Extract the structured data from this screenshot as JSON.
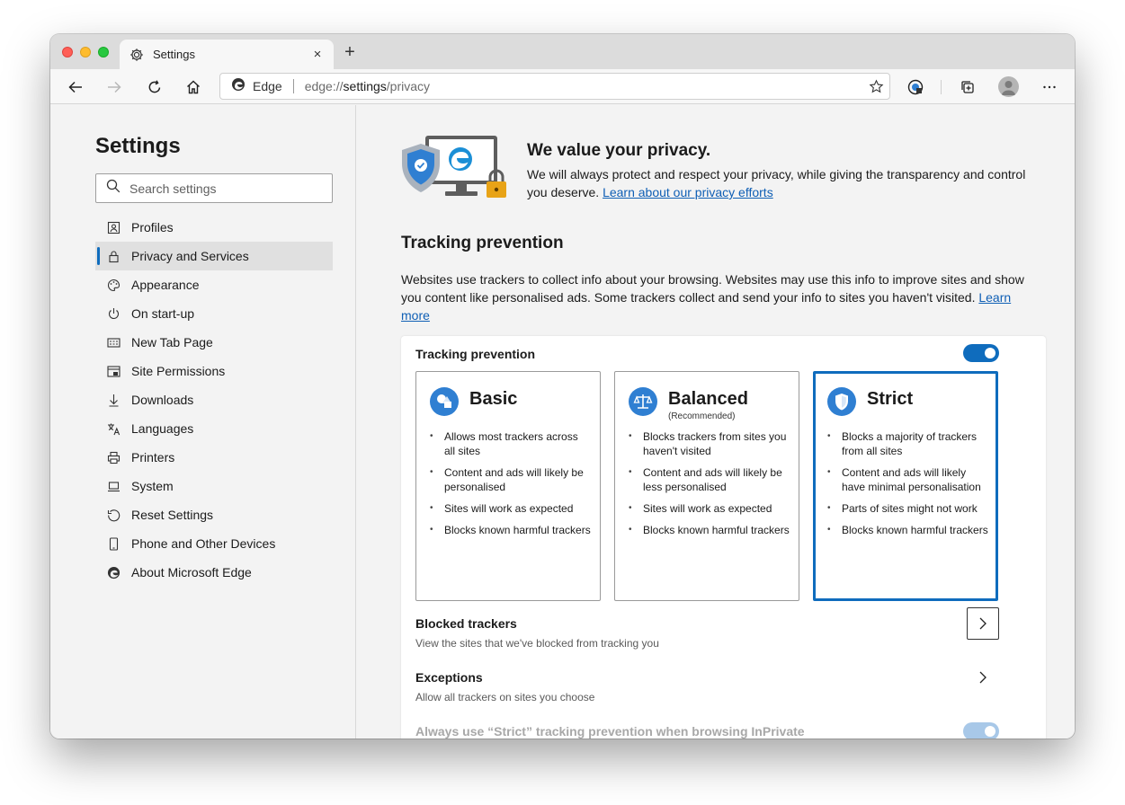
{
  "tab": {
    "title": "Settings",
    "close": "×",
    "new": "+"
  },
  "address": {
    "brand": "Edge",
    "url_scheme": "edge://",
    "url_path": "settings",
    "url_rest": "/privacy"
  },
  "sidebar": {
    "title": "Settings",
    "search_placeholder": "Search settings",
    "items": [
      {
        "label": "Profiles",
        "icon": "profile-icon"
      },
      {
        "label": "Privacy and Services",
        "icon": "lock-icon",
        "active": true
      },
      {
        "label": "Appearance",
        "icon": "palette-icon"
      },
      {
        "label": "On start-up",
        "icon": "power-icon"
      },
      {
        "label": "New Tab Page",
        "icon": "new-tab-page-icon"
      },
      {
        "label": "Site Permissions",
        "icon": "site-permissions-icon"
      },
      {
        "label": "Downloads",
        "icon": "download-icon"
      },
      {
        "label": "Languages",
        "icon": "languages-icon"
      },
      {
        "label": "Printers",
        "icon": "printer-icon"
      },
      {
        "label": "System",
        "icon": "laptop-icon"
      },
      {
        "label": "Reset Settings",
        "icon": "reset-icon"
      },
      {
        "label": "Phone and Other Devices",
        "icon": "phone-icon"
      },
      {
        "label": "About Microsoft Edge",
        "icon": "edge-logo-icon"
      }
    ]
  },
  "hero": {
    "title": "We value your privacy.",
    "text": "We will always protect and respect your privacy, while giving the transparency and control you deserve.",
    "link": "Learn about our privacy efforts"
  },
  "tracking": {
    "title": "Tracking prevention",
    "desc": "Websites use trackers to collect info about your browsing. Websites may use this info to improve sites and show you content like personalised ads. Some trackers collect and send your info to sites you haven't visited.",
    "learn_more": "Learn more",
    "card_label": "Tracking prevention",
    "enabled": true,
    "levels": [
      {
        "name": "Basic",
        "sub": "",
        "bullets": [
          "Allows most trackers across all sites",
          "Content and ads will likely be personalised",
          "Sites will work as expected",
          "Blocks known harmful trackers"
        ]
      },
      {
        "name": "Balanced",
        "sub": "(Recommended)",
        "bullets": [
          "Blocks trackers from sites you haven't visited",
          "Content and ads will likely be less personalised",
          "Sites will work as expected",
          "Blocks known harmful trackers"
        ]
      },
      {
        "name": "Strict",
        "sub": "",
        "selected": true,
        "bullets": [
          "Blocks a majority of trackers from all sites",
          "Content and ads will likely have minimal personalisation",
          "Parts of sites might not work",
          "Blocks known harmful trackers"
        ]
      }
    ],
    "blocked": {
      "title": "Blocked trackers",
      "sub": "View the sites that we've blocked from tracking you"
    },
    "exceptions": {
      "title": "Exceptions",
      "sub": "Allow all trackers on sites you choose"
    },
    "inprivate": {
      "title": "Always use “Strict” tracking prevention when browsing InPrivate",
      "enabled": true
    }
  },
  "colors": {
    "accent": "#0f6cbd",
    "link": "#0f5fb5",
    "background": "#f3f3f3"
  }
}
